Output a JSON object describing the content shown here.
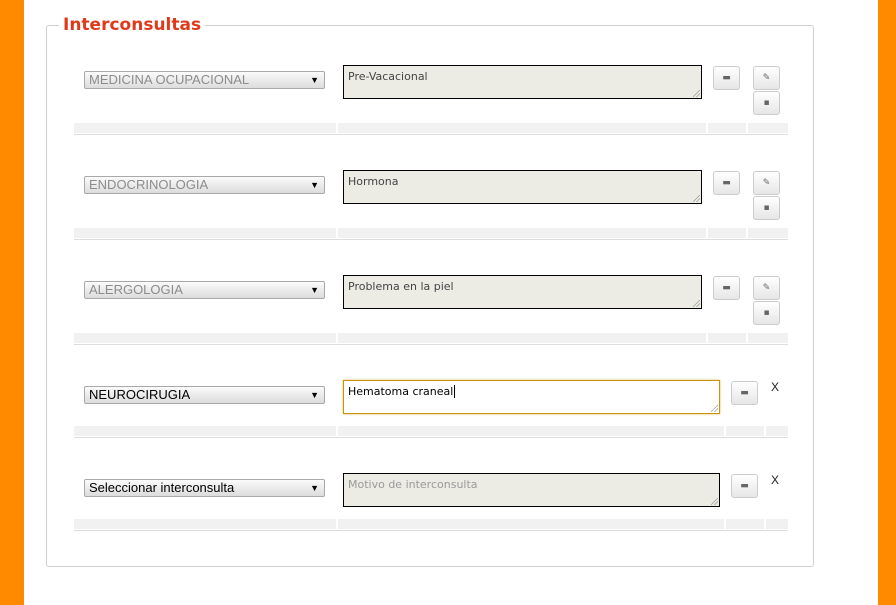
{
  "panel": {
    "legend": "Interconsultas"
  },
  "rows": [
    {
      "specialty": "MEDICINA OCUPACIONAL",
      "reason": "Pre-Vacacional",
      "state": "saved"
    },
    {
      "specialty": "ENDOCRINOLOGIA",
      "reason": "Hormona",
      "state": "saved"
    },
    {
      "specialty": "ALERGOLOGIA",
      "reason": "Problema en la piel",
      "state": "saved"
    },
    {
      "specialty": "NEUROCIRUGIA",
      "reason": "Hematoma craneal",
      "state": "editing",
      "close_label": "X"
    },
    {
      "specialty": "Seleccionar interconsulta",
      "reason_placeholder": "Motivo de interconsulta",
      "reason": "",
      "state": "new",
      "close_label": "X"
    }
  ],
  "icons": {
    "print": "print-icon",
    "edit": "pencil-icon",
    "delete": "trash-icon",
    "dropdown": "chevron-down-icon"
  },
  "colors": {
    "accent_orange": "#ff8a00",
    "legend_red": "#e03a1c",
    "focus_border": "#c79410"
  }
}
